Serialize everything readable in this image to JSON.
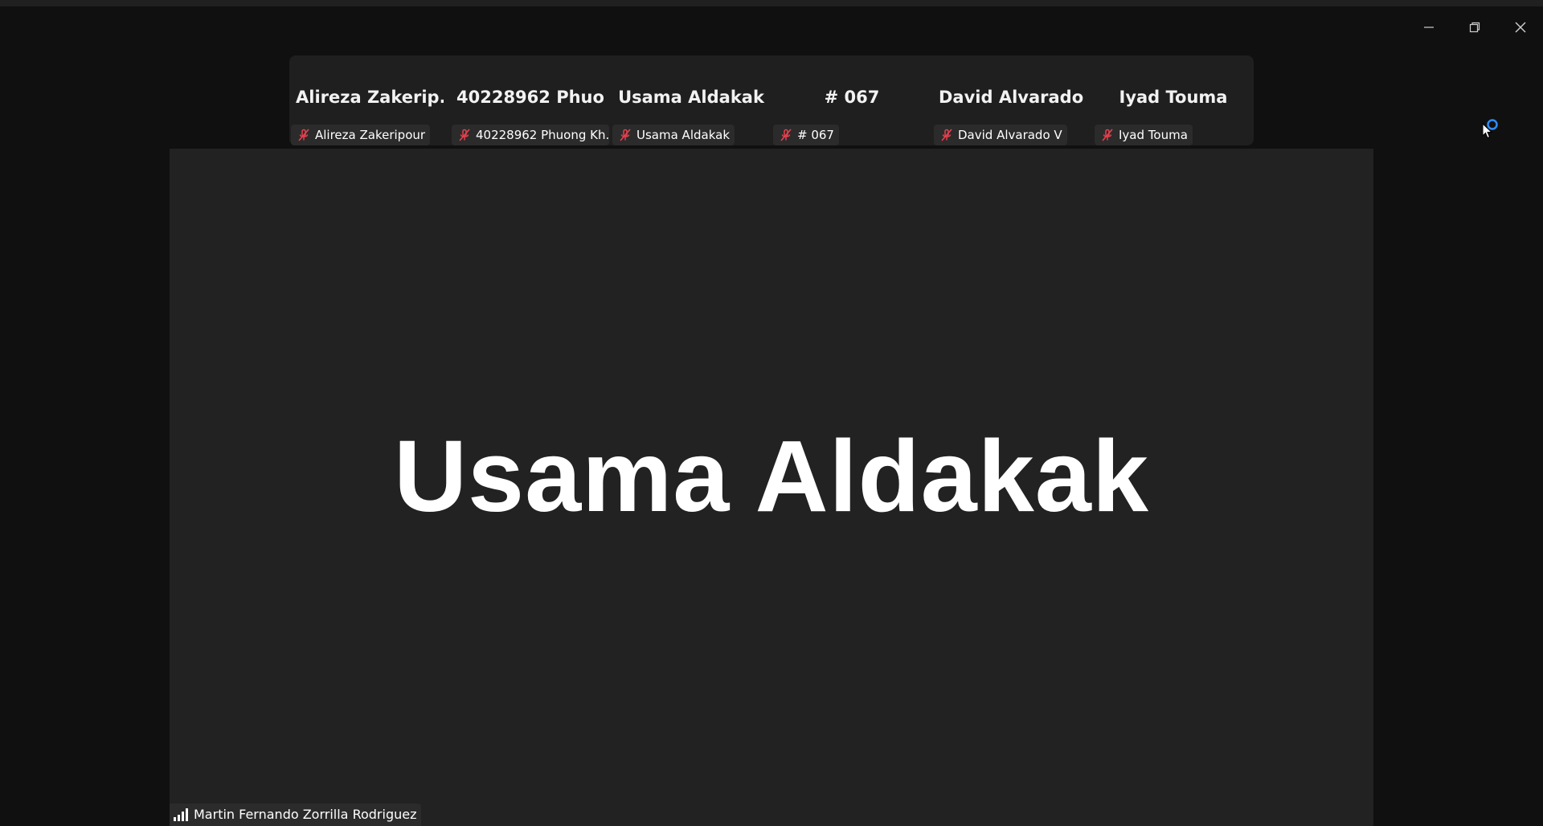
{
  "window_controls": {
    "minimize_icon": "minimize-icon",
    "restore_icon": "restore-icon",
    "close_icon": "close-icon"
  },
  "strip": {
    "tiles": [
      {
        "display_name": "Alireza  Zakerip...",
        "label": "Alireza Zakeripour"
      },
      {
        "display_name": "40228962  Phuo...",
        "label": "40228962 Phuong Kh..."
      },
      {
        "display_name": "Usama Aldakak",
        "label": "Usama Aldakak"
      },
      {
        "display_name": "# 067",
        "label": "# 067"
      },
      {
        "display_name": "David Alvarado V",
        "label": "David Alvarado V"
      },
      {
        "display_name": "Iyad Touma",
        "label": "Iyad Touma"
      }
    ],
    "muted_icon": "muted-microphone-icon"
  },
  "main": {
    "speaker_name": "Usama Aldakak",
    "self_label": "Martin Fernando Zorrilla Rodriguez",
    "signal_icon": "signal-strength-icon"
  },
  "colors": {
    "window_bg": "#101010",
    "video_bg": "#222222",
    "strip_bg": "#1f1f1f",
    "muted_red": "#e8404f",
    "spinner_blue": "#2d8cff"
  }
}
